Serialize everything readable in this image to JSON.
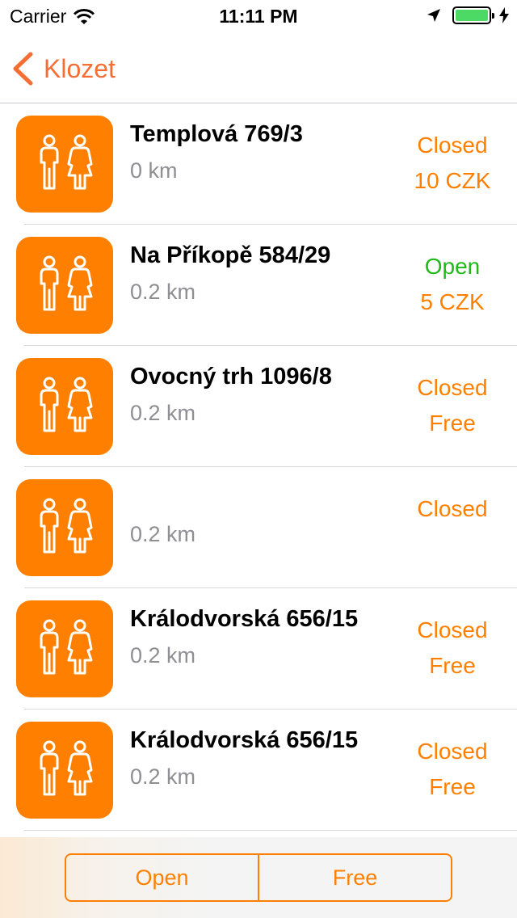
{
  "status_bar": {
    "carrier": "Carrier",
    "time": "11:11 PM",
    "battery_color": "#4cd964"
  },
  "nav": {
    "back_label": "Klozet",
    "accent_color": "#f76e35"
  },
  "toilets": [
    {
      "title": "Templová 769/3",
      "distance": "0 km",
      "status": "Closed",
      "status_color": "#ff8000",
      "price": "10 CZK",
      "icon": "restroom-icon"
    },
    {
      "title": "Na Příkopě 584/29",
      "distance": "0.2 km",
      "status": "Open",
      "status_color": "#21b81a",
      "price": "5 CZK",
      "icon": "restroom-icon"
    },
    {
      "title": "Ovocný trh 1096/8",
      "distance": "0.2 km",
      "status": "Closed",
      "status_color": "#ff8000",
      "price": "Free",
      "icon": "restroom-icon"
    },
    {
      "title": "",
      "distance": "0.2 km",
      "status": "Closed",
      "status_color": "#ff8000",
      "price": "",
      "icon": "restroom-icon"
    },
    {
      "title": "Králodvorská 656/15",
      "distance": "0.2 km",
      "status": "Closed",
      "status_color": "#ff8000",
      "price": "Free",
      "icon": "restroom-icon"
    },
    {
      "title": "Králodvorská 656/15",
      "distance": "0.2 km",
      "status": "Closed",
      "status_color": "#ff8000",
      "price": "Free",
      "icon": "restroom-icon"
    }
  ],
  "filter": {
    "open_label": "Open",
    "free_label": "Free",
    "accent_color": "#ff8000"
  }
}
